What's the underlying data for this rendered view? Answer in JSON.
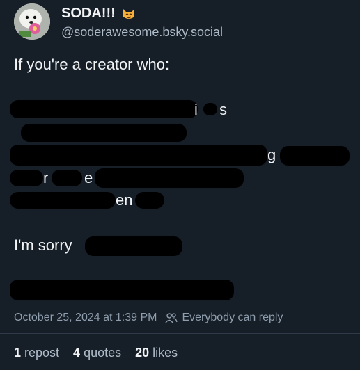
{
  "post": {
    "author": {
      "display_name": "SODA!!!",
      "name_emoji_icon": "smiling-cat-icon",
      "handle": "@soderawesome.bsky.social"
    },
    "text": {
      "line1": "If you're a creator who:",
      "fragments": {
        "f_i": "i",
        "f_s": "s",
        "f_g": "g",
        "f_r": "r",
        "f_e": "e",
        "f_en": "en"
      },
      "sorry": "I'm sorry"
    },
    "timestamp": "October 25, 2024 at 1:39 PM",
    "reply_setting": "Everybody can reply",
    "stats": {
      "reposts_count": "1",
      "reposts_label": "repost",
      "quotes_count": "4",
      "quotes_label": "quotes",
      "likes_count": "20",
      "likes_label": "likes"
    }
  }
}
